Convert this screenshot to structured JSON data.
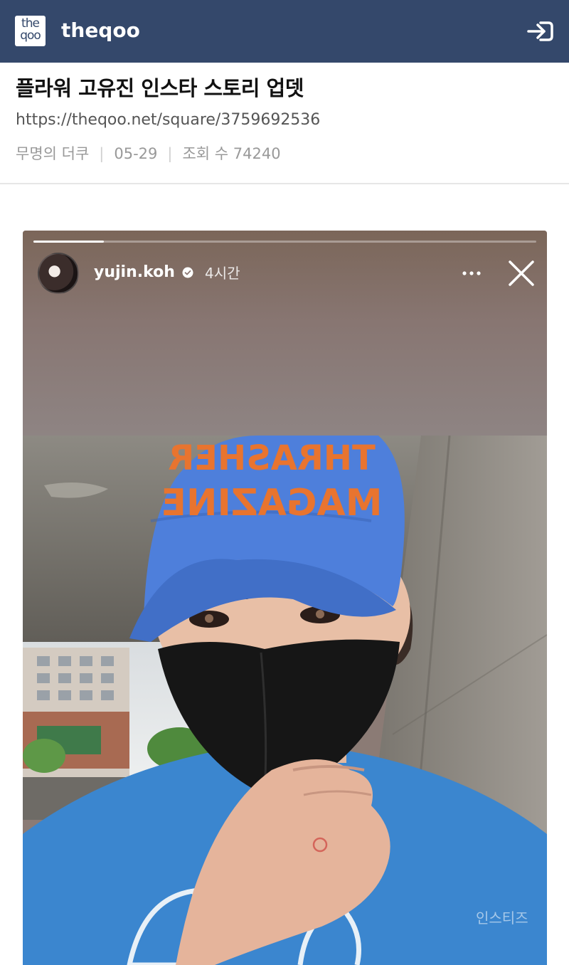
{
  "header": {
    "logo_line1": "the",
    "logo_line2": "qoo",
    "brand": "theqoo",
    "login_icon": "login-arrow-icon",
    "bar_color": "#34486b"
  },
  "post": {
    "title": "플라워 고유진 인스타 스토리 업뎃",
    "url": "https://theqoo.net/square/3759692536",
    "author": "무명의 더쿠",
    "date": "05-29",
    "views_label": "조회 수",
    "views": "74240"
  },
  "story": {
    "username": "yujin.koh",
    "time": "4시간",
    "progress": 0.14,
    "more_icon": "more-dots-icon",
    "close_icon": "close-icon",
    "verified_icon": "verified-badge-icon",
    "watermark": "인스티즈",
    "cap_text_line1": "THRASHER",
    "cap_text_line2": "MAGAZINE"
  }
}
